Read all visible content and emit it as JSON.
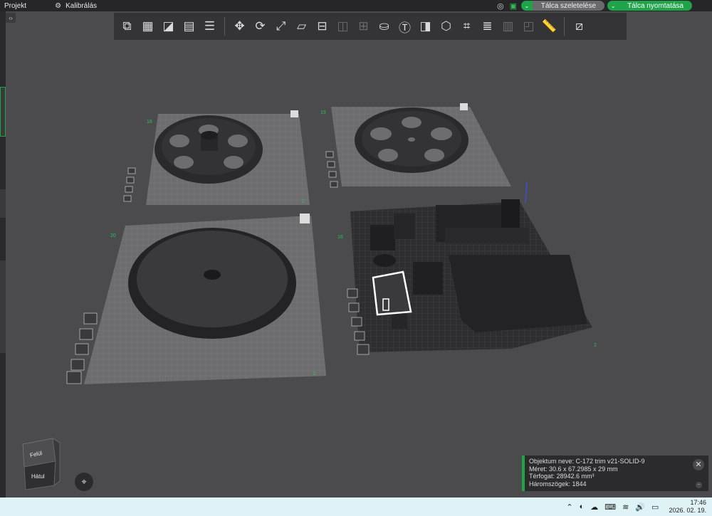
{
  "menu": {
    "project": "Projekt",
    "calibration": "Kalibrálás"
  },
  "top_actions": {
    "slice_plate": "Tálca szeletelése",
    "print_plate": "Tálca nyomtatása"
  },
  "toolbar": {
    "tools": [
      "add-cube-icon",
      "grid-add-icon",
      "auto-orient-icon",
      "arrange-icon",
      "layers-icon",
      "move-icon",
      "rotate-icon",
      "scale-icon",
      "lay-flat-icon",
      "cut-icon",
      "support-paint-icon",
      "seam-paint-icon",
      "color-paint-icon",
      "text-icon",
      "measure-icon",
      "assembly-icon",
      "boolean-icon",
      "slice-layers-icon",
      "variable-layer-icon",
      "split-objects-icon",
      "split-parts-icon",
      "ruler-icon",
      "view-settings-icon"
    ]
  },
  "plates": {
    "labels": [
      "18",
      "19",
      "20",
      "16"
    ],
    "corner_mark": "2"
  },
  "view_cube": {
    "top_face": "Felül",
    "front_face": "Hátul"
  },
  "object_info": {
    "line1": "Objektum neve: C-172 trim v21-SOLID-9",
    "line2": "Méret: 30.6 x 67.2985 x 29 mm",
    "line3": "Térfogat: 28942.6 mm³",
    "line4": "Háromszögek: 1844"
  },
  "taskbar": {
    "time": "17:46",
    "date": "2026. 02. 19."
  },
  "colors": {
    "accent": "#1fa44a",
    "background": "#4b4b4e",
    "toolbar": "#343437",
    "taskbar": "#dff2f5"
  }
}
